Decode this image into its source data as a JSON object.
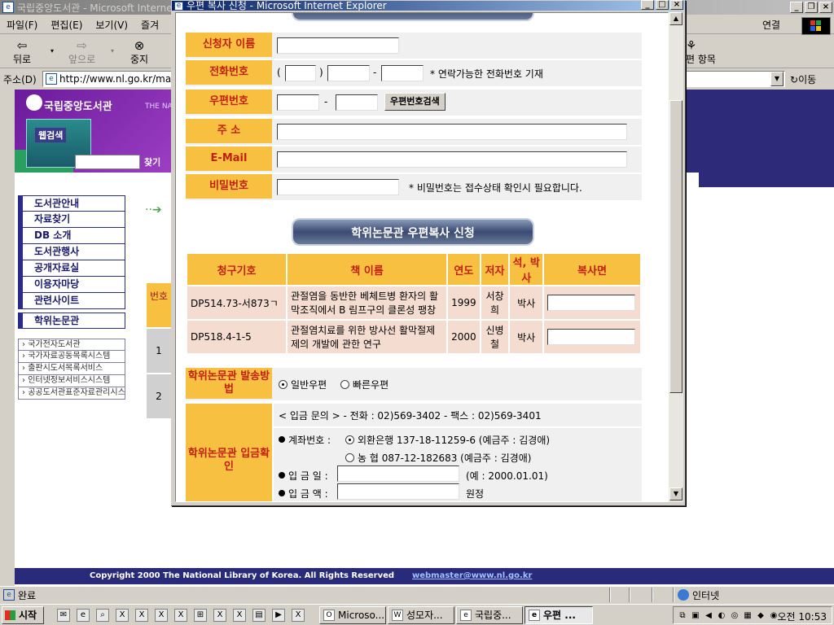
{
  "main_window": {
    "title": "국립중앙도서관 - Microsoft Interne",
    "menu": [
      "파일(F)",
      "편집(E)",
      "보기(V)",
      "즐겨"
    ],
    "connect": "연결",
    "toolbar": {
      "back": "뒤로",
      "forward": "앞으로",
      "stop": "중지",
      "favorites": "편 항목"
    },
    "address_label": "주소(D)",
    "address_url": "http://www.nl.go.kr/ma",
    "go_label": "이동"
  },
  "webpage": {
    "logo_text": "국립중앙도서관",
    "logo_sub": "THE NA",
    "search_tile": "웹검색",
    "find_button": "찾기",
    "nav": [
      "도서관안내",
      "자료찾기",
      "DB 소개",
      "도서관행사",
      "공개자료실",
      "이용자마당",
      "관련사이트",
      "학위논문관"
    ],
    "side_links": [
      "국가전자도서관",
      "국가자료공동목록시스템",
      "출판시도서목록서비스",
      "인터넷정보서비스시스템",
      "공공도서관표준자료관리시스템"
    ],
    "num_col": {
      "head": "번호",
      "rows": [
        "1",
        "2"
      ]
    },
    "footer_copy": "Copyright 2000 The National Library of Korea. All Rights Reserved",
    "footer_mail": "webmaster@www.nl.go.kr"
  },
  "statusbar": {
    "text": "완료",
    "zone": "인터넷"
  },
  "taskbar": {
    "start": "시작",
    "tasks": [
      {
        "label": "Microso...",
        "active": false
      },
      {
        "label": "성모자...",
        "active": false
      },
      {
        "label": "국립중...",
        "active": false
      },
      {
        "label": "우편 ...",
        "active": true
      }
    ],
    "clock": "오전 10:53"
  },
  "popup": {
    "title": "우편 복사 신청 - Microsoft Internet Explorer",
    "form": {
      "applicant_label": "신청자 이름",
      "phone_label": "전화번호",
      "phone_open": "(",
      "phone_close": ")",
      "phone_dash": "-",
      "phone_note": "* 연락가능한 전화번호 기재",
      "zip_label": "우편번호",
      "zip_dash": "-",
      "zip_search_button": "우편번호검색",
      "address_label": "주 소",
      "email_label": "E-Mail",
      "password_label": "비밀번호",
      "password_note": "* 비밀번호는 접수상태 확인시 필요합니다."
    },
    "section_header": "학위논문관 우편복사 신청",
    "table": {
      "headers": [
        "청구기호",
        "책 이름",
        "연도",
        "저자",
        "석, 박사",
        "복사면"
      ],
      "rows": [
        {
          "call_no": "DP514.73-서873ㄱ",
          "title": "관절염을 동반한 베체트병 환자의 활막조직에서 B 림프구의 클론성 팽창",
          "year": "1999",
          "author": "서창희",
          "degree": "박사"
        },
        {
          "call_no": "DP518.4-1-5",
          "title": "관절염치료를 위한 방사선 활막절제제의 개발에 관한 연구",
          "year": "2000",
          "author": "신병철",
          "degree": "박사"
        }
      ]
    },
    "shipping": {
      "label": "학위논문관 발송방법",
      "option_normal": "일반우편",
      "option_fast": "빠른우편"
    },
    "deposit": {
      "label": "학위논문관 입금확인",
      "inquiry": "< 입금 문의 > - 전화 : 02)569-3402    - 팩스 : 02)569-3401",
      "account_label": "계좌번호 :",
      "account_1": "외환은행 137-18-11259-6 (예금주 : 김경애)",
      "account_2": "농  협 087-12-182683 (예금주 : 김경애)",
      "date_label": "입 금 일 :",
      "date_example": "(예 : 2000.01.01)",
      "amount_label": "입 금 액 :",
      "amount_unit": "원정"
    }
  }
}
